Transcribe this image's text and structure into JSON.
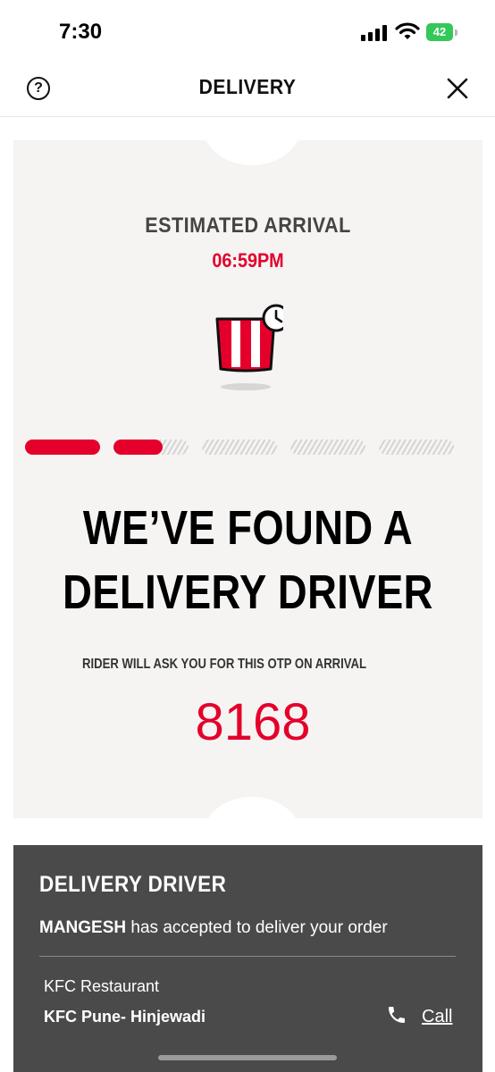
{
  "status_bar": {
    "time": "7:30",
    "battery": "42"
  },
  "header": {
    "title": "DELIVERY",
    "help_icon": "?",
    "close_icon": "close-icon"
  },
  "ticket": {
    "eta_label": "ESTIMATED ARRIVAL",
    "eta_time": "06:59PM",
    "progress": {
      "total_steps": 5,
      "completed_steps": 1.65
    },
    "headline_line1": "WE’VE FOUND A",
    "headline_line2": "DELIVERY DRIVER",
    "otp_label": "RIDER WILL ASK YOU FOR THIS OTP ON ARRIVAL",
    "otp_code": "8168"
  },
  "driver": {
    "title": "DELIVERY DRIVER",
    "driver_name": "MANGESH",
    "message": " has accepted to deliver your order",
    "restaurant_label": "KFC Restaurant",
    "restaurant_name": "KFC Pune- Hinjewadi",
    "call_label": "Call"
  },
  "colors": {
    "accent": "#e4002b",
    "panel": "#4a4a4a",
    "card": "#f5f4f3"
  }
}
